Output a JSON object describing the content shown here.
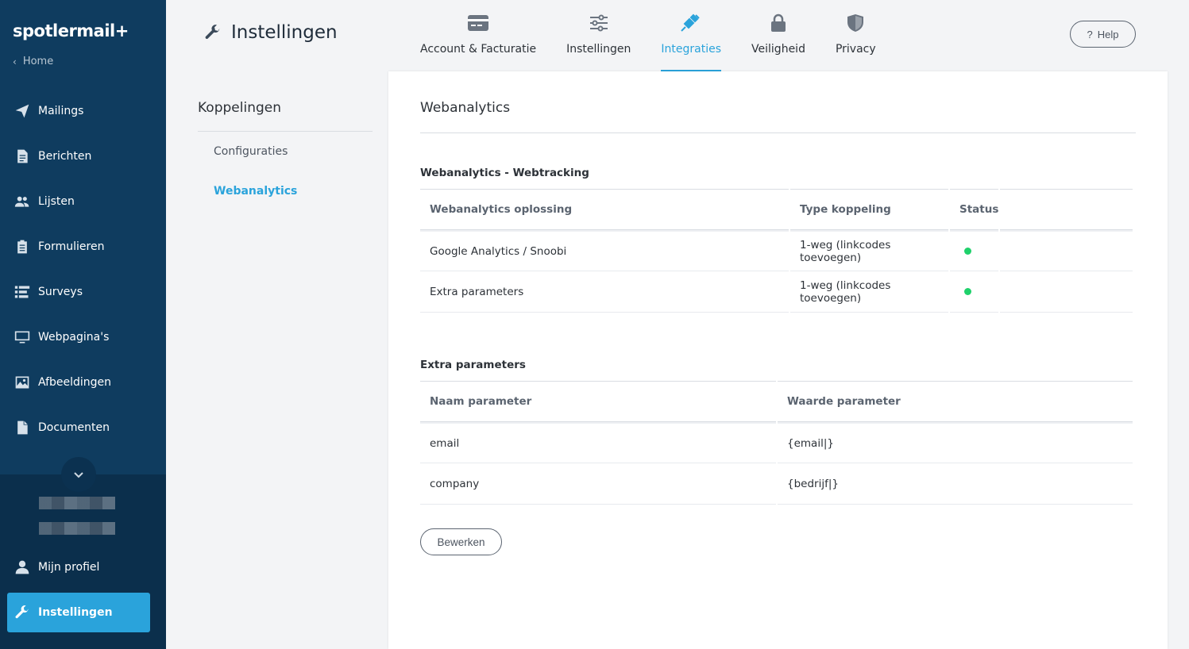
{
  "app": {
    "logo_text": "spotlermail+",
    "home_label": "Home"
  },
  "sidebar": {
    "items": [
      {
        "label": "Mailings",
        "icon": "paper-plane-icon"
      },
      {
        "label": "Berichten",
        "icon": "document-icon"
      },
      {
        "label": "Lijsten",
        "icon": "users-icon"
      },
      {
        "label": "Formulieren",
        "icon": "clipboard-icon"
      },
      {
        "label": "Surveys",
        "icon": "list-icon"
      },
      {
        "label": "Webpagina's",
        "icon": "monitor-icon"
      },
      {
        "label": "Afbeeldingen",
        "icon": "image-icon"
      },
      {
        "label": "Documenten",
        "icon": "file-icon"
      }
    ],
    "profile_label": "Mijn profiel",
    "active_label": "Instellingen"
  },
  "header": {
    "title": "Instellingen",
    "tabs": [
      {
        "label": "Account & Facturatie",
        "icon": "credit-card-icon"
      },
      {
        "label": "Instellingen",
        "icon": "sliders-icon"
      },
      {
        "label": "Integraties",
        "icon": "plug-icon",
        "active": true
      },
      {
        "label": "Veiligheid",
        "icon": "lock-icon"
      },
      {
        "label": "Privacy",
        "icon": "shield-icon"
      }
    ],
    "help_label": "Help",
    "help_glyph": "?"
  },
  "subnav": {
    "heading": "Koppelingen",
    "items": [
      {
        "label": "Configuraties"
      },
      {
        "label": "Webanalytics",
        "active": true
      }
    ]
  },
  "main": {
    "title": "Webanalytics",
    "webtracking": {
      "title": "Webanalytics - Webtracking",
      "columns": [
        "Webanalytics oplossing",
        "Type koppeling",
        "Status"
      ],
      "rows": [
        {
          "solution": "Google Analytics / Snoobi",
          "type": "1-weg (linkcodes toevoegen)",
          "status": "active"
        },
        {
          "solution": "Extra parameters",
          "type": "1-weg (linkcodes toevoegen)",
          "status": "active"
        }
      ]
    },
    "extra": {
      "title": "Extra parameters",
      "columns": [
        "Naam parameter",
        "Waarde parameter"
      ],
      "rows": [
        {
          "name": "email",
          "value": "{email|}"
        },
        {
          "name": "company",
          "value": "{bedrijf|}"
        }
      ]
    },
    "edit_label": "Bewerken"
  },
  "colors": {
    "sidebar_bg": "#0f3c5f",
    "accent": "#2aa3db",
    "status_active": "#1fd16b"
  }
}
